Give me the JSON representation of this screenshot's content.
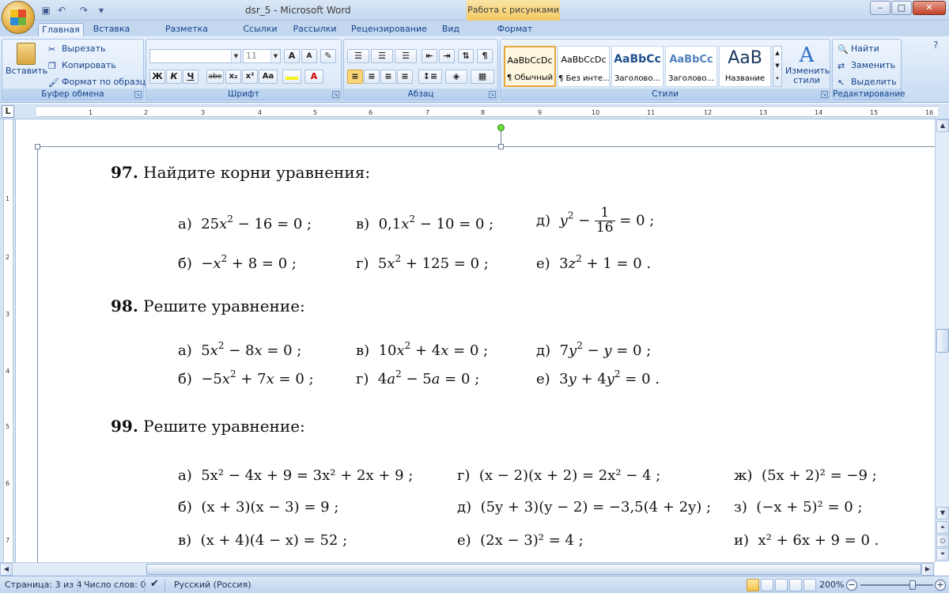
{
  "window": {
    "title": "dsr_5 - Microsoft Word",
    "context_tab": "Работа с рисунками",
    "controls": [
      "–",
      "□",
      "✕"
    ]
  },
  "tabs": [
    "Главная",
    "Вставка",
    "Разметка страницы",
    "Ссылки",
    "Рассылки",
    "Рецензирование",
    "Вид",
    "Формат"
  ],
  "active_tab": "Главная",
  "clipboard": {
    "paste": "Вставить",
    "cut": "Вырезать",
    "copy": "Копировать",
    "format_painter": "Формат по образцу",
    "label": "Буфер обмена"
  },
  "font": {
    "size": "11",
    "label": "Шрифт",
    "bold": "Ж",
    "italic": "К",
    "underline": "Ч",
    "strike": "abe",
    "sub": "x₂",
    "sup": "x²",
    "case": "Aa",
    "grow": "A",
    "shrink": "A"
  },
  "paragraph": {
    "label": "Абзац"
  },
  "styles": {
    "label": "Стили",
    "items": [
      {
        "preview": "AaBbCcDc",
        "name": "¶ Обычный"
      },
      {
        "preview": "AaBbCcDc",
        "name": "¶ Без инте..."
      },
      {
        "preview": "AaBbCc",
        "name": "Заголово..."
      },
      {
        "preview": "AaBbCc",
        "name": "Заголово..."
      },
      {
        "preview": "AaB",
        "name": "Название"
      }
    ],
    "change": "Изменить стили"
  },
  "editing": {
    "label": "Редактирование",
    "find": "Найти",
    "replace": "Заменить",
    "select": "Выделить"
  },
  "ruler": {
    "h_ticks": [
      "1",
      "2",
      "3",
      "4",
      "5",
      "6",
      "7",
      "8",
      "9",
      "10",
      "11",
      "12",
      "13",
      "14",
      "15",
      "16"
    ],
    "v_ticks": [
      "1",
      "2",
      "3",
      "4",
      "5",
      "6",
      "7"
    ]
  },
  "document": {
    "p97": {
      "num": "97.",
      "text": "Найдите корни уравнения:",
      "a": "а)",
      "b": "б)",
      "v": "в)",
      "g": "г)",
      "d": "д)",
      "e": "е)",
      "eq_a": [
        "25",
        "x",
        "2",
        " − 16 = 0 ;"
      ],
      "eq_b": [
        "−",
        "x",
        "2",
        " + 8 = 0 ;"
      ],
      "eq_v": [
        "0,1",
        "x",
        "2",
        " − 10 = 0 ;"
      ],
      "eq_g": [
        "5",
        "x",
        "2",
        " + 125 = 0 ;"
      ],
      "eq_d": [
        "y",
        "2",
        " − ",
        "1",
        "16",
        " = 0 ;"
      ],
      "eq_e": [
        "3",
        "z",
        "2",
        " + 1 = 0 ."
      ]
    },
    "p98": {
      "num": "98.",
      "text": "Решите уравнение:",
      "a": "а)",
      "b": "б)",
      "v": "в)",
      "g": "г)",
      "d": "д)",
      "e": "е)",
      "eq_a": [
        "5",
        "x",
        "2",
        " − 8",
        "x",
        " = 0 ;"
      ],
      "eq_b": [
        "−5",
        "x",
        "2",
        " + 7",
        "x",
        " = 0 ;"
      ],
      "eq_v": [
        "10",
        "x",
        "2",
        " + 4",
        "x",
        " = 0 ;"
      ],
      "eq_g": [
        "4",
        "a",
        "2",
        " − 5",
        "a",
        " = 0 ;"
      ],
      "eq_d": [
        "7",
        "y",
        "2",
        " − ",
        "y",
        " = 0 ;"
      ],
      "eq_e": [
        "3",
        "y",
        " + 4",
        "y",
        "2",
        " = 0 ."
      ]
    },
    "p99": {
      "num": "99.",
      "text": "Решите уравнение:",
      "a": "а)",
      "b": "б)",
      "v": "в)",
      "g": "г)",
      "d": "д)",
      "e": "е)",
      "zh": "ж)",
      "z": "з)",
      "i": "и)",
      "eq_a": "5x² − 4x + 9 = 3x² + 2x + 9 ;",
      "eq_b": "(x + 3)(x − 3) = 9 ;",
      "eq_v": "(x + 4)(4 − x) = 52 ;",
      "eq_g": "(x − 2)(x + 2) = 2x² − 4 ;",
      "eq_d": "(5y + 3)(y − 2) = −3,5(4 + 2y) ;",
      "eq_e": "(2x − 3)² = 4 ;",
      "eq_zh": "(5x + 2)² = −9 ;",
      "eq_z": "(−x + 5)² = 0 ;",
      "eq_i": "x² + 6x + 9 = 0 ."
    }
  },
  "status": {
    "page": "Страница: 3 из 4",
    "words": "Число слов: 0",
    "language": "Русский (Россия)",
    "zoom": "200%"
  }
}
